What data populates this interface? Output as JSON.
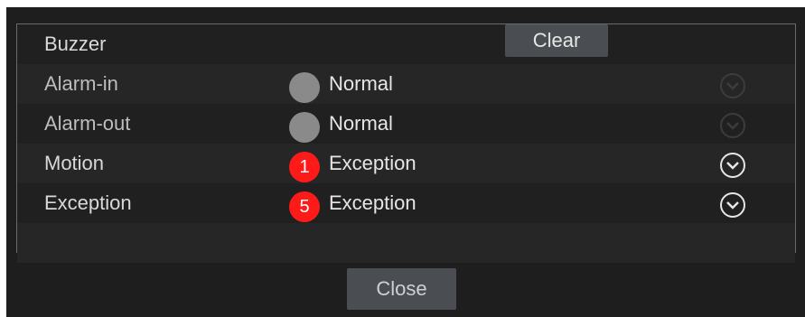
{
  "rows": [
    {
      "label": "Buzzer",
      "action": "Clear"
    },
    {
      "label": "Alarm-in",
      "status": "Normal",
      "badge": ""
    },
    {
      "label": "Alarm-out",
      "status": "Normal",
      "badge": ""
    },
    {
      "label": "Motion",
      "status": "Exception",
      "badge": "1"
    },
    {
      "label": "Exception",
      "status": "Exception",
      "badge": "5"
    }
  ],
  "footer": {
    "close_label": "Close"
  },
  "icons": {
    "status": "status-dot-icon",
    "expand": "chevron-down-icon"
  },
  "colors": {
    "normal_dot": "#8a8a8a",
    "exception_dot": "#ff1a1a",
    "dialog_bg": "#1e1e1e",
    "button_bg": "#4a4d52"
  }
}
